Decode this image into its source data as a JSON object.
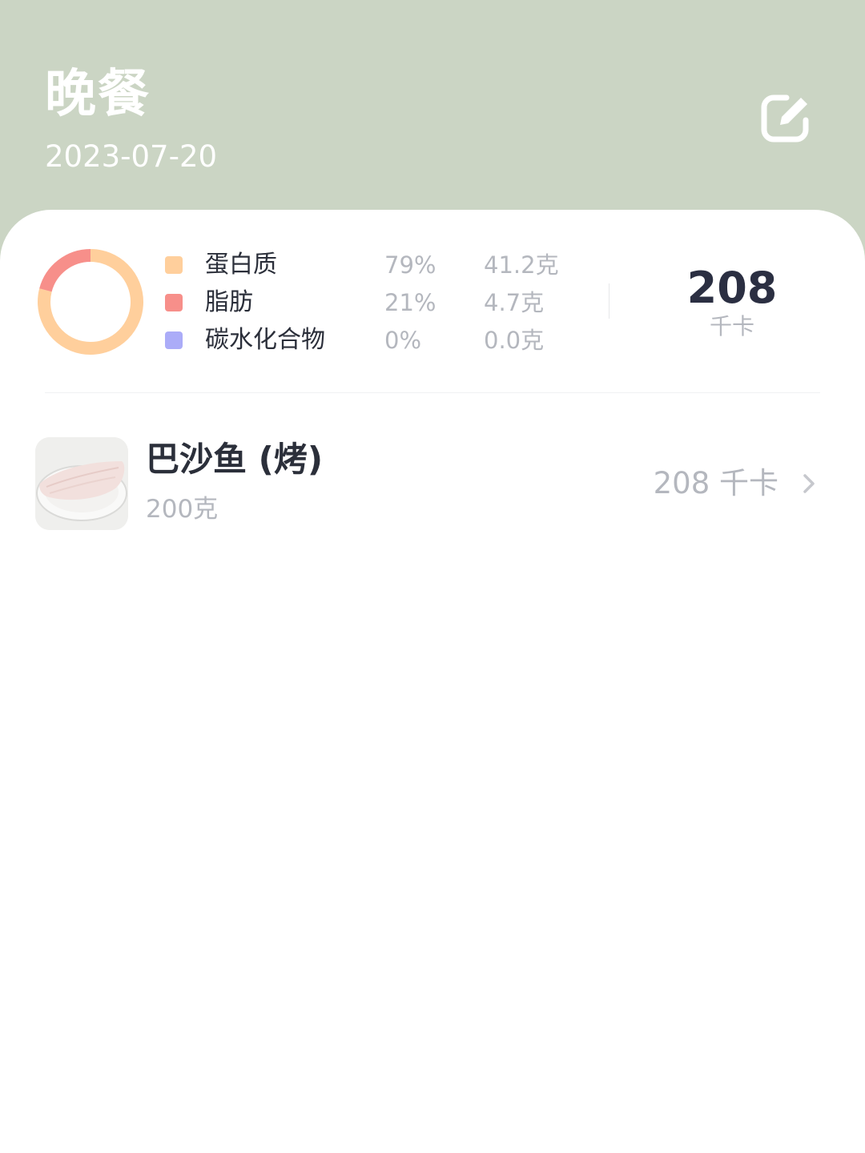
{
  "header": {
    "title": "晚餐",
    "date": "2023-07-20",
    "edit_icon": "edit-icon"
  },
  "summary": {
    "macros": [
      {
        "name": "蛋白质",
        "percent": "79%",
        "amount": "41.2克",
        "color": "#ffcf9c",
        "fraction": 0.79
      },
      {
        "name": "脂肪",
        "percent": "21%",
        "amount": "4.7克",
        "color": "#f78f8a",
        "fraction": 0.21
      },
      {
        "name": "碳水化合物",
        "percent": "0%",
        "amount": "0.0克",
        "color": "#abacf8",
        "fraction": 0
      }
    ],
    "total_calories": "208",
    "total_unit": "千卡"
  },
  "foods": [
    {
      "name": "巴沙鱼 (烤)",
      "amount": "200克",
      "calories": "208 千卡",
      "chevron_icon": "chevron-right-icon"
    }
  ],
  "colors": {
    "header_bg": "#cbd5c4",
    "card_bg": "#ffffff",
    "primary_text": "#2b2f3a",
    "secondary_text": "#b4b7be"
  }
}
